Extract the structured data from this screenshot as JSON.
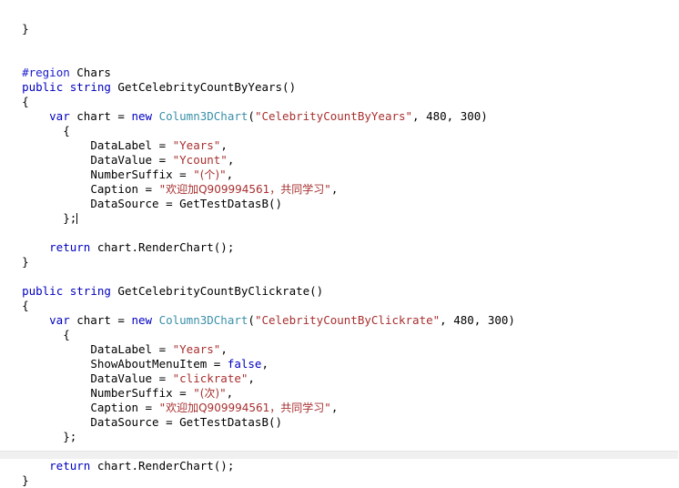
{
  "editor": {
    "language": "csharp",
    "background_color": "#ffffff",
    "foreground_color": "#000000",
    "keyword_color": "#0000c0",
    "type_color": "#3a8fa8",
    "string_color": "#a82f2f",
    "preprocessor_color": "#1a1acc",
    "caret_line_index": 12
  },
  "code": {
    "lines": [
      {
        "indent": 0,
        "tokens": []
      },
      {
        "indent": 2,
        "tokens": [
          {
            "kind": "plain",
            "text": "}"
          }
        ]
      },
      {
        "indent": 0,
        "tokens": []
      },
      {
        "indent": 0,
        "tokens": []
      },
      {
        "indent": 2,
        "tokens": [
          {
            "kind": "preproc",
            "text": "#region"
          },
          {
            "kind": "plain",
            "text": " Chars"
          }
        ]
      },
      {
        "indent": 2,
        "tokens": [
          {
            "kind": "keyword",
            "text": "public"
          },
          {
            "kind": "plain",
            "text": " "
          },
          {
            "kind": "keyword",
            "text": "string"
          },
          {
            "kind": "plain",
            "text": " GetCelebrityCountByYears()"
          }
        ]
      },
      {
        "indent": 2,
        "tokens": [
          {
            "kind": "plain",
            "text": "{"
          }
        ]
      },
      {
        "indent": 6,
        "tokens": [
          {
            "kind": "keyword",
            "text": "var"
          },
          {
            "kind": "plain",
            "text": " chart = "
          },
          {
            "kind": "keyword",
            "text": "new"
          },
          {
            "kind": "plain",
            "text": " "
          },
          {
            "kind": "type",
            "text": "Column3DChart"
          },
          {
            "kind": "plain",
            "text": "("
          },
          {
            "kind": "string",
            "text": "\"CelebrityCountByYears\""
          },
          {
            "kind": "plain",
            "text": ", 480, 300)"
          }
        ]
      },
      {
        "indent": 8,
        "tokens": [
          {
            "kind": "plain",
            "text": "{"
          }
        ]
      },
      {
        "indent": 12,
        "tokens": [
          {
            "kind": "plain",
            "text": "DataLabel = "
          },
          {
            "kind": "string",
            "text": "\"Years\""
          },
          {
            "kind": "plain",
            "text": ","
          }
        ]
      },
      {
        "indent": 12,
        "tokens": [
          {
            "kind": "plain",
            "text": "DataValue = "
          },
          {
            "kind": "string",
            "text": "\"Ycount\""
          },
          {
            "kind": "plain",
            "text": ","
          }
        ]
      },
      {
        "indent": 12,
        "tokens": [
          {
            "kind": "plain",
            "text": "NumberSuffix = "
          },
          {
            "kind": "string",
            "text": "\""
          },
          {
            "kind": "cjk",
            "text": "(个)"
          },
          {
            "kind": "string",
            "text": "\""
          },
          {
            "kind": "plain",
            "text": ","
          }
        ]
      },
      {
        "indent": 12,
        "tokens": [
          {
            "kind": "plain",
            "text": "Caption = "
          },
          {
            "kind": "string",
            "text": "\""
          },
          {
            "kind": "cjk",
            "text": "欢迎加Q909994561，共同学习"
          },
          {
            "kind": "string",
            "text": "\""
          },
          {
            "kind": "plain",
            "text": ","
          }
        ]
      },
      {
        "indent": 12,
        "tokens": [
          {
            "kind": "plain",
            "text": "DataSource = GetTestDatasB()"
          }
        ]
      },
      {
        "indent": 8,
        "tokens": [
          {
            "kind": "plain",
            "text": "};"
          }
        ],
        "caret": true
      },
      {
        "indent": 0,
        "tokens": []
      },
      {
        "indent": 6,
        "tokens": [
          {
            "kind": "keyword",
            "text": "return"
          },
          {
            "kind": "plain",
            "text": " chart.RenderChart();"
          }
        ]
      },
      {
        "indent": 2,
        "tokens": [
          {
            "kind": "plain",
            "text": "}"
          }
        ]
      },
      {
        "indent": 0,
        "tokens": []
      },
      {
        "indent": 2,
        "tokens": [
          {
            "kind": "keyword",
            "text": "public"
          },
          {
            "kind": "plain",
            "text": " "
          },
          {
            "kind": "keyword",
            "text": "string"
          },
          {
            "kind": "plain",
            "text": " GetCelebrityCountByClickrate()"
          }
        ]
      },
      {
        "indent": 2,
        "tokens": [
          {
            "kind": "plain",
            "text": "{"
          }
        ]
      },
      {
        "indent": 6,
        "tokens": [
          {
            "kind": "keyword",
            "text": "var"
          },
          {
            "kind": "plain",
            "text": " chart = "
          },
          {
            "kind": "keyword",
            "text": "new"
          },
          {
            "kind": "plain",
            "text": " "
          },
          {
            "kind": "type",
            "text": "Column3DChart"
          },
          {
            "kind": "plain",
            "text": "("
          },
          {
            "kind": "string",
            "text": "\"CelebrityCountByClickrate\""
          },
          {
            "kind": "plain",
            "text": ", 480, 300)"
          }
        ]
      },
      {
        "indent": 8,
        "tokens": [
          {
            "kind": "plain",
            "text": "{"
          }
        ]
      },
      {
        "indent": 12,
        "tokens": [
          {
            "kind": "plain",
            "text": "DataLabel = "
          },
          {
            "kind": "string",
            "text": "\"Years\""
          },
          {
            "kind": "plain",
            "text": ","
          }
        ]
      },
      {
        "indent": 12,
        "tokens": [
          {
            "kind": "plain",
            "text": "ShowAboutMenuItem = "
          },
          {
            "kind": "keyword",
            "text": "false"
          },
          {
            "kind": "plain",
            "text": ","
          }
        ]
      },
      {
        "indent": 12,
        "tokens": [
          {
            "kind": "plain",
            "text": "DataValue = "
          },
          {
            "kind": "string",
            "text": "\"clickrate\""
          },
          {
            "kind": "plain",
            "text": ","
          }
        ]
      },
      {
        "indent": 12,
        "tokens": [
          {
            "kind": "plain",
            "text": "NumberSuffix = "
          },
          {
            "kind": "string",
            "text": "\""
          },
          {
            "kind": "cjk",
            "text": "(次)"
          },
          {
            "kind": "string",
            "text": "\""
          },
          {
            "kind": "plain",
            "text": ","
          }
        ]
      },
      {
        "indent": 12,
        "tokens": [
          {
            "kind": "plain",
            "text": "Caption = "
          },
          {
            "kind": "string",
            "text": "\""
          },
          {
            "kind": "cjk",
            "text": "欢迎加Q909994561，共同学习"
          },
          {
            "kind": "string",
            "text": "\""
          },
          {
            "kind": "plain",
            "text": ","
          }
        ]
      },
      {
        "indent": 12,
        "tokens": [
          {
            "kind": "plain",
            "text": "DataSource = GetTestDatasB()"
          }
        ]
      },
      {
        "indent": 8,
        "tokens": [
          {
            "kind": "plain",
            "text": "};"
          }
        ]
      },
      {
        "indent": 0,
        "tokens": []
      },
      {
        "indent": 6,
        "tokens": [
          {
            "kind": "keyword",
            "text": "return"
          },
          {
            "kind": "plain",
            "text": " chart.RenderChart();"
          }
        ]
      },
      {
        "indent": 2,
        "tokens": [
          {
            "kind": "plain",
            "text": "}"
          }
        ]
      }
    ]
  }
}
